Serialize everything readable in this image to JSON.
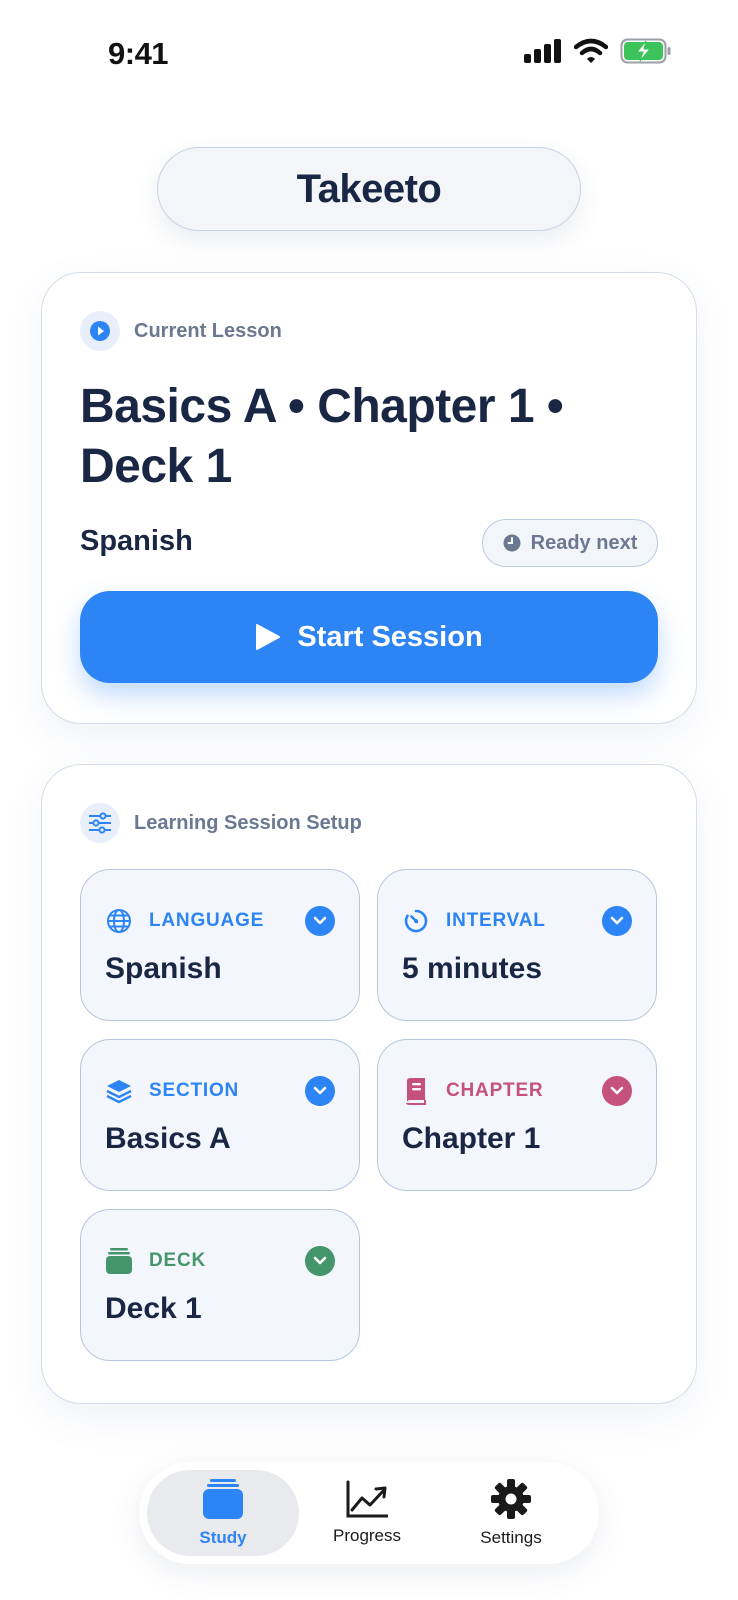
{
  "status_bar": {
    "time": "9:41"
  },
  "app": {
    "title": "Takeeto"
  },
  "current_lesson": {
    "header": "Current Lesson",
    "title": "Basics A • Chapter 1 • Deck 1",
    "language": "Spanish",
    "status": "Ready next",
    "start_label": "Start Session"
  },
  "setup": {
    "header": "Learning Session Setup",
    "tiles": [
      {
        "label": "LANGUAGE",
        "value": "Spanish",
        "icon": "globe-icon",
        "color": "#2d84f4"
      },
      {
        "label": "INTERVAL",
        "value": "5 minutes",
        "icon": "timer-icon",
        "color": "#2d84f4"
      },
      {
        "label": "SECTION",
        "value": "Basics A",
        "icon": "layers-icon",
        "color": "#2d84f4"
      },
      {
        "label": "CHAPTER",
        "value": "Chapter 1",
        "icon": "book-icon",
        "color": "#c4527d"
      },
      {
        "label": "DECK",
        "value": "Deck 1",
        "icon": "cards-icon",
        "color": "#45956a"
      }
    ]
  },
  "tabs": [
    {
      "label": "Study",
      "icon": "cards-stack-icon",
      "active": true
    },
    {
      "label": "Progress",
      "icon": "chart-icon",
      "active": false
    },
    {
      "label": "Settings",
      "icon": "gear-icon",
      "active": false
    }
  ],
  "colors": {
    "accent": "#2d84f4",
    "text": "#1a2744",
    "muted": "#6b7891",
    "chapter": "#c4527d",
    "deck": "#45956a",
    "battery": "#3cc45a"
  }
}
